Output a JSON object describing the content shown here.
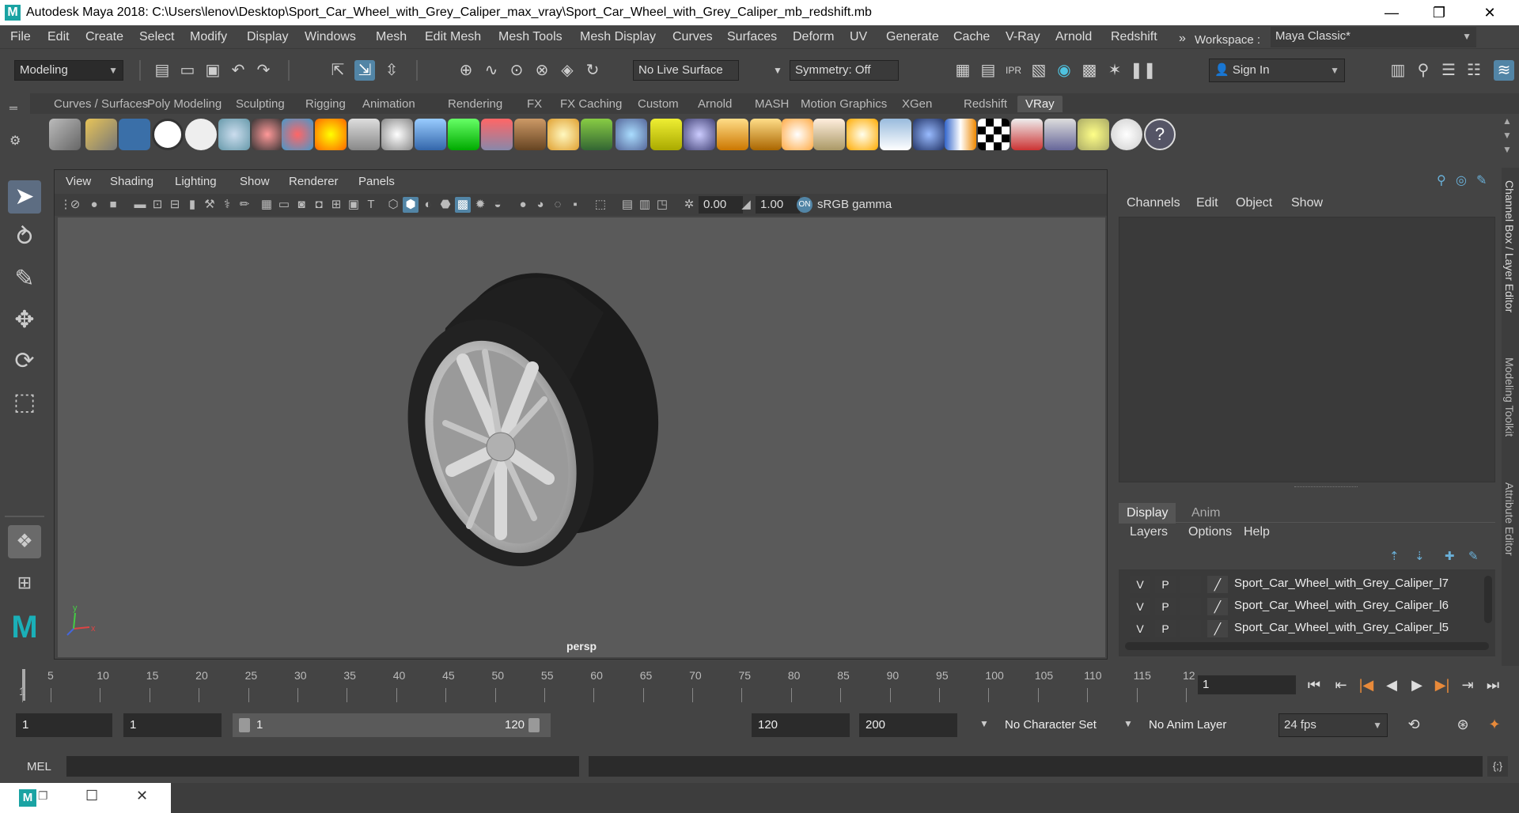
{
  "window": {
    "title": "Autodesk Maya 2018: C:\\Users\\lenov\\Desktop\\Sport_Car_Wheel_with_Grey_Caliper_max_vray\\Sport_Car_Wheel_with_Grey_Caliper_mb_redshift.mb",
    "logo": "M",
    "minimize": "—",
    "restore": "❐",
    "close": "✕"
  },
  "menubar": {
    "items": [
      "File",
      "Edit",
      "Create",
      "Select",
      "Modify",
      "Display",
      "Windows",
      "Mesh",
      "Edit Mesh",
      "Mesh Tools",
      "Mesh Display",
      "Curves",
      "Surfaces",
      "Deform",
      "UV",
      "Generate",
      "Cache",
      "V-Ray",
      "Arnold",
      "Redshift"
    ],
    "more": "»",
    "workspace_label": "Workspace :",
    "workspace_value": "Maya Classic*"
  },
  "statusline": {
    "mode": "Modeling",
    "live_surface": "No Live Surface",
    "symmetry": "Symmetry: Off",
    "sign_in": "Sign In"
  },
  "shelf": {
    "tabs": [
      "Curves / Surfaces",
      "Poly Modeling",
      "Sculpting",
      "Rigging",
      "Animation",
      "Rendering",
      "FX",
      "FX Caching",
      "Custom",
      "Arnold",
      "MASH",
      "Motion Graphics",
      "XGen",
      "Redshift",
      "VRay"
    ],
    "active_tab": "VRay"
  },
  "viewport": {
    "menus": [
      "View",
      "Shading",
      "Lighting",
      "Show",
      "Renderer",
      "Panels"
    ],
    "exposure": "0.00",
    "gamma": "1.00",
    "color_space": "sRGB gamma",
    "camera": "persp",
    "axis_x": "x",
    "axis_y": "y"
  },
  "channelbox": {
    "menus": [
      "Channels",
      "Edit",
      "Object",
      "Show"
    ],
    "tabs": [
      "Display",
      "Anim"
    ],
    "active_tab": "Display",
    "layer_menus": [
      "Layers",
      "Options",
      "Help"
    ],
    "layers": [
      {
        "v": "V",
        "p": "P",
        "name": "Sport_Car_Wheel_with_Grey_Caliper_l7"
      },
      {
        "v": "V",
        "p": "P",
        "name": "Sport_Car_Wheel_with_Grey_Caliper_l6"
      },
      {
        "v": "V",
        "p": "P",
        "name": "Sport_Car_Wheel_with_Grey_Caliper_l5"
      }
    ],
    "side_tabs": [
      "Channel Box / Layer Editor",
      "Modeling Toolkit",
      "Attribute Editor"
    ]
  },
  "timeslider": {
    "ticks": [
      "1",
      "5",
      "10",
      "15",
      "20",
      "25",
      "30",
      "35",
      "40",
      "45",
      "50",
      "55",
      "60",
      "65",
      "70",
      "75",
      "80",
      "85",
      "90",
      "95",
      "100",
      "105",
      "110",
      "115",
      "12"
    ],
    "current_frame": "1"
  },
  "range": {
    "start": "1",
    "playback_start": "1",
    "slider_start": "1",
    "slider_end": "120",
    "playback_end": "120",
    "end": "200",
    "character_set": "No Character Set",
    "anim_layer": "No Anim Layer",
    "fps": "24 fps"
  },
  "cmdline": {
    "label": "MEL"
  }
}
